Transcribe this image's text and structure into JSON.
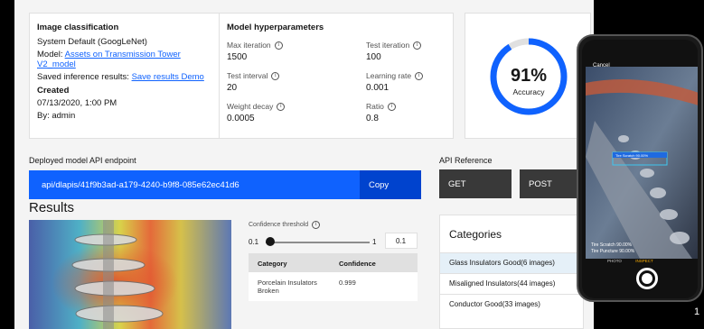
{
  "image_classification": {
    "heading": "Image classification",
    "system": "System Default (GoogLeNet)",
    "model_label": "Model:",
    "model_link": "Assets on Transmission Tower V2_model",
    "saved_label": "Saved inference results:",
    "saved_link": "Save results Demo",
    "created_heading": "Created",
    "created_date": "07/13/2020, 1:00 PM",
    "created_by": "By: admin"
  },
  "hyperparameters": {
    "heading": "Model hyperparameters",
    "items": [
      {
        "label": "Max iteration",
        "value": "1500"
      },
      {
        "label": "Test iteration",
        "value": "100"
      },
      {
        "label": "Test interval",
        "value": "20"
      },
      {
        "label": "Learning rate",
        "value": "0.001"
      },
      {
        "label": "Weight decay",
        "value": "0.0005"
      },
      {
        "label": "Ratio",
        "value": "0.8"
      }
    ]
  },
  "accuracy": {
    "value": "91%",
    "label": "Accuracy",
    "fraction": 0.91,
    "color": "#0f62fe"
  },
  "endpoint": {
    "label": "Deployed model API endpoint",
    "url": "api/dlapis/41f9b3ad-a179-4240-b9f8-085e62ec41d6",
    "copy_label": "Copy"
  },
  "api_reference": {
    "label": "API Reference",
    "get_label": "GET",
    "post_label": "POST"
  },
  "results": {
    "heading": "Results",
    "confidence_threshold_label": "Confidence threshold",
    "slider_min": "0.1",
    "slider_max": "1",
    "threshold_value": "0.1",
    "table": {
      "headers": [
        "Category",
        "Confidence"
      ],
      "rows": [
        {
          "category": "Porcelain Insulators Broken",
          "confidence": "0.999"
        }
      ]
    }
  },
  "categories": {
    "heading": "Categories",
    "items": [
      "Glass Insulators Good(6 images)",
      "Misaligned Insulators(44 images)",
      "Conductor Good(33 images)"
    ],
    "selected_index": 0
  },
  "phone": {
    "cancel": "Cancel",
    "detection_label": "Tire Scratch 90.00%",
    "results": [
      "Tire Scratch 90.00%",
      "Tire Puncture 90.00%"
    ],
    "modes": [
      "PHOTO",
      "INSPECT"
    ]
  },
  "page_number": "1"
}
